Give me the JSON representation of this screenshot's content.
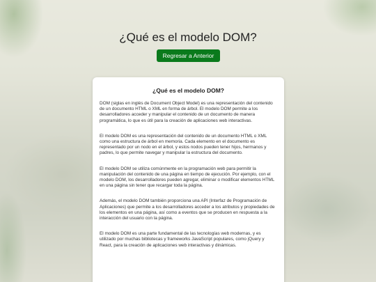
{
  "page": {
    "title": "¿Qué es el modelo DOM?",
    "back_button_label": "Regresar a Anterior"
  },
  "card": {
    "title": "¿Qué es el modelo DOM?",
    "paragraphs": [
      "DOM (siglas en inglés de Document Object Model) es una representación del contenido de un documento HTML o XML en forma de árbol. El modelo DOM permite a los desarrolladores acceder y manipular el contenido de un documento de manera programática, lo que es útil para la creación de aplicaciones web interactivas.",
      "El modelo DOM es una representación del contenido de un documento HTML o XML como una estructura de árbol en memoria. Cada elemento en el documento es representado por un nodo en el árbol, y estos nodos pueden tener hijos, hermanos y padres, lo que permite navegar y manipular la estructura del documento.",
      "El modelo DOM se utiliza comúnmente en la programación web para permitir la manipulación del contenido de una página en tiempo de ejecución. Por ejemplo, con el modelo DOM, los desarrolladores pueden agregar, eliminar o modificar elementos HTML en una página sin tener que recargar toda la página.",
      "Además, el modelo DOM también proporciona una API (Interfaz de Programación de Aplicaciones) que permite a los desarrolladores acceder a los atributos y propiedades de los elementos en una página, así como a eventos que se producen en respuesta a la interacción del usuario con la página.",
      "El modelo DOM es una parte fundamental de las tecnologías web modernas, y es utilizado por muchas bibliotecas y frameworks JavaScript populares, como jQuery y React, para la creación de aplicaciones web interactivas y dinámicas."
    ]
  },
  "colors": {
    "button_background": "#0a7a1c",
    "button_text": "#ffffff",
    "card_background": "#ffffff"
  }
}
